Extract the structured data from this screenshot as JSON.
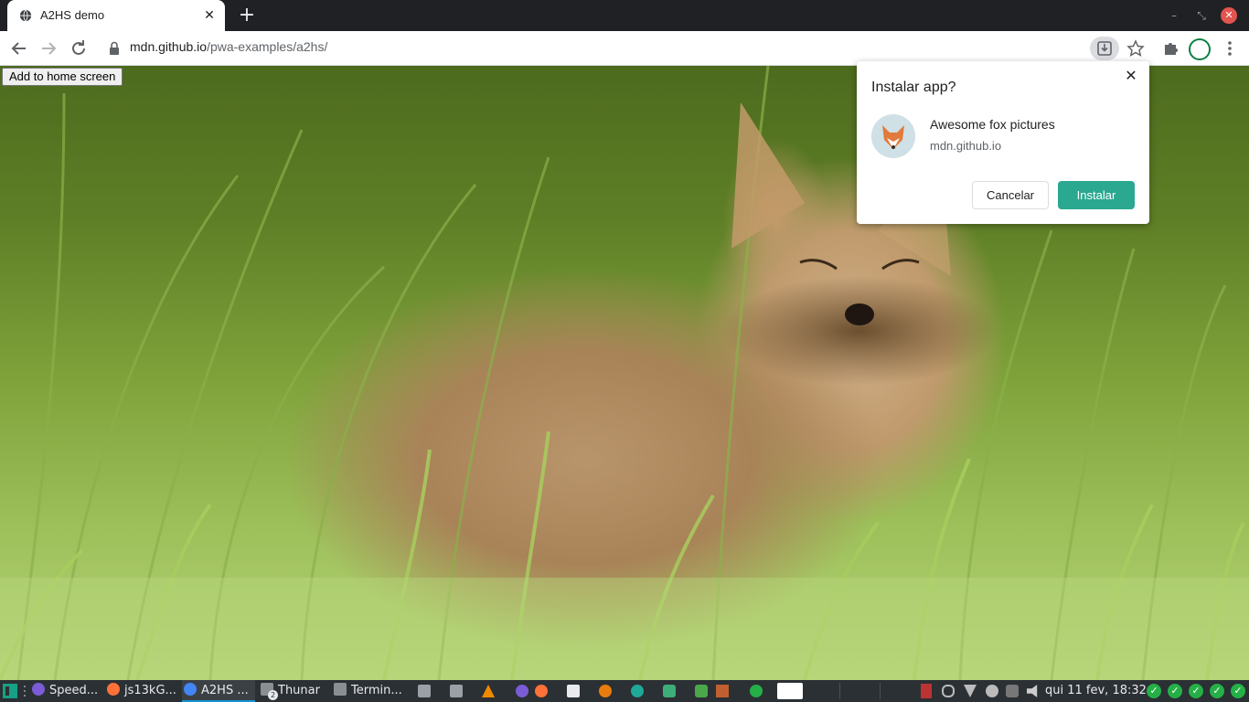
{
  "browser": {
    "tab_title": "A2HS demo",
    "tab_close_glyph": "✕",
    "new_tab_glyph": "+",
    "url_host": "mdn.github.io",
    "url_path": "/pwa-examples/a2hs/",
    "window_minimize_glyph": "–",
    "window_restore_glyph": "⤡",
    "window_close_glyph": "✕",
    "accent": "#1a73e8"
  },
  "page": {
    "add_button_label": "Add to home screen",
    "image": "fox-in-grass"
  },
  "install_dialog": {
    "title": "Instalar app?",
    "close_glyph": "✕",
    "app_name": "Awesome fox pictures",
    "app_origin": "mdn.github.io",
    "cancel_label": "Cancelar",
    "install_label": "Instalar",
    "install_color": "#2aa890"
  },
  "taskbar": {
    "items": [
      {
        "label": "Speed...",
        "icon": "speedcrunch-icon",
        "color": "#7b5cd6"
      },
      {
        "label": "js13kG...",
        "icon": "firefox-icon",
        "color": "#ff7139"
      },
      {
        "label": "A2HS ...",
        "icon": "chrome-icon",
        "color": "#4285f4"
      },
      {
        "label": "Thunar",
        "icon": "folder-icon",
        "color": "#8a8f94",
        "badge": "2"
      },
      {
        "label": "Termin...",
        "icon": "terminal-icon",
        "color": "#8a8f94"
      }
    ],
    "clock": "qui 11 fev, 18:32",
    "check_glyph": "✓"
  }
}
